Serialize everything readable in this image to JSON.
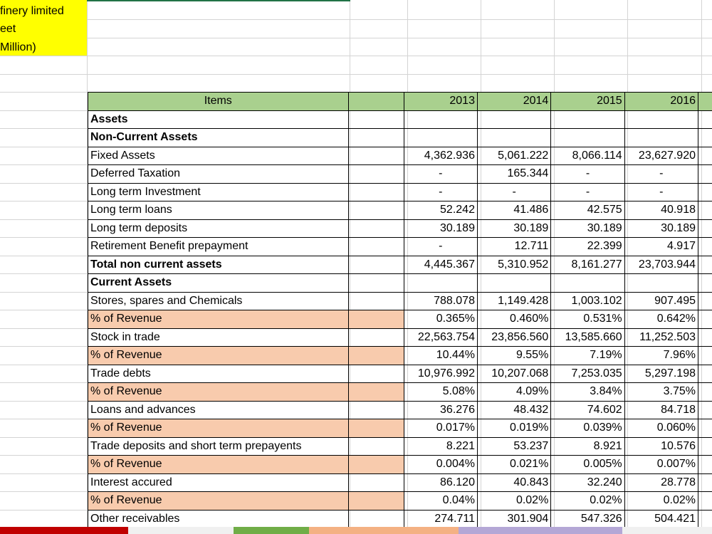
{
  "title_lines": [
    "finery limited",
    "eet",
    "Million)"
  ],
  "columns": {
    "items": "Items",
    "years": [
      "2013",
      "2014",
      "2015",
      "2016"
    ]
  },
  "rows": [
    {
      "label": "Assets",
      "bold": true,
      "pct": false,
      "values": [
        "",
        "",
        "",
        ""
      ]
    },
    {
      "label": "Non-Current Assets",
      "bold": true,
      "pct": false,
      "values": [
        "",
        "",
        "",
        ""
      ]
    },
    {
      "label": "Fixed Assets",
      "bold": false,
      "pct": false,
      "values": [
        "4,362.936",
        "5,061.222",
        "8,066.114",
        "23,627.920"
      ]
    },
    {
      "label": "Deferred Taxation",
      "bold": false,
      "pct": false,
      "values": [
        "-",
        "165.344",
        "-",
        "-"
      ]
    },
    {
      "label": "Long term Investment",
      "bold": false,
      "pct": false,
      "values": [
        "-",
        "-",
        "-",
        "-"
      ]
    },
    {
      "label": "Long  term loans",
      "bold": false,
      "pct": false,
      "values": [
        "52.242",
        "41.486",
        "42.575",
        "40.918"
      ]
    },
    {
      "label": "Long term deposits",
      "bold": false,
      "pct": false,
      "values": [
        "30.189",
        "30.189",
        "30.189",
        "30.189"
      ]
    },
    {
      "label": "Retirement Benefit prepayment",
      "bold": false,
      "pct": false,
      "values": [
        "-",
        "12.711",
        "22.399",
        "4.917"
      ]
    },
    {
      "label": "Total non current assets",
      "bold": true,
      "pct": false,
      "values": [
        "4,445.367",
        "5,310.952",
        "8,161.277",
        "23,703.944"
      ]
    },
    {
      "label": "Current Assets",
      "bold": true,
      "pct": false,
      "values": [
        "",
        "",
        "",
        ""
      ]
    },
    {
      "label": "Stores, spares and Chemicals",
      "bold": false,
      "pct": false,
      "values": [
        "788.078",
        "1,149.428",
        "1,003.102",
        "907.495"
      ]
    },
    {
      "label": "% of Revenue",
      "bold": false,
      "pct": true,
      "values": [
        "0.365%",
        "0.460%",
        "0.531%",
        "0.642%"
      ]
    },
    {
      "label": "Stock in trade",
      "bold": false,
      "pct": false,
      "values": [
        "22,563.754",
        "23,856.560",
        "13,585.660",
        "11,252.503"
      ]
    },
    {
      "label": "% of Revenue",
      "bold": false,
      "pct": true,
      "values": [
        "10.44%",
        "9.55%",
        "7.19%",
        "7.96%"
      ]
    },
    {
      "label": "Trade debts",
      "bold": false,
      "pct": false,
      "values": [
        "10,976.992",
        "10,207.068",
        "7,253.035",
        "5,297.198"
      ]
    },
    {
      "label": "% of Revenue",
      "bold": false,
      "pct": true,
      "values": [
        "5.08%",
        "4.09%",
        "3.84%",
        "3.75%"
      ]
    },
    {
      "label": "Loans and advances",
      "bold": false,
      "pct": false,
      "values": [
        "36.276",
        "48.432",
        "74.602",
        "84.718"
      ]
    },
    {
      "label": "% of Revenue",
      "bold": false,
      "pct": true,
      "values": [
        "0.017%",
        "0.019%",
        "0.039%",
        "0.060%"
      ]
    },
    {
      "label": "Trade deposits and short term prepayents",
      "bold": false,
      "pct": false,
      "values": [
        "8.221",
        "53.237",
        "8.921",
        "10.576"
      ]
    },
    {
      "label": "% of Revenue",
      "bold": false,
      "pct": true,
      "values": [
        "0.004%",
        "0.021%",
        "0.005%",
        "0.007%"
      ]
    },
    {
      "label": "Interest accured",
      "bold": false,
      "pct": false,
      "values": [
        "86.120",
        "40.843",
        "32.240",
        "28.778"
      ]
    },
    {
      "label": "% of Revenue",
      "bold": false,
      "pct": true,
      "values": [
        "0.04%",
        "0.02%",
        "0.02%",
        "0.02%"
      ]
    },
    {
      "label": "Other receivables",
      "bold": false,
      "pct": false,
      "values": [
        "274.711",
        "301.904",
        "547.326",
        "504.421"
      ]
    }
  ],
  "colors": {
    "header_green": "#a9d08e",
    "pct_salmon": "#f8cbad",
    "title_yellow": "#ffff00"
  }
}
